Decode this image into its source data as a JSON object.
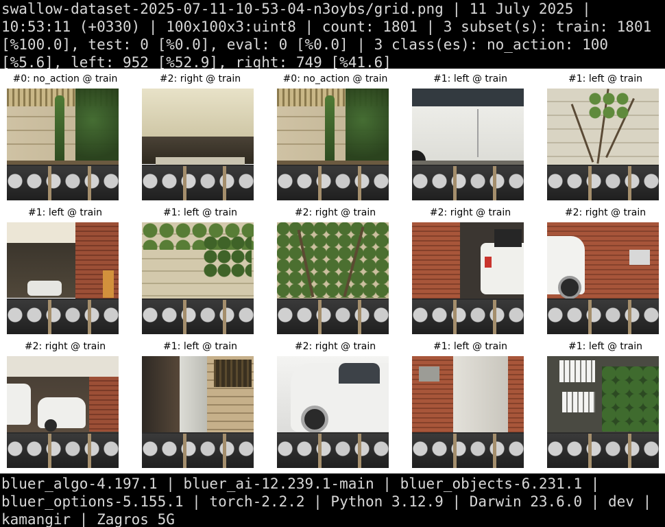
{
  "header": {
    "text": "swallow-dataset-2025-07-11-10-53-04-n3oybs/grid.png | 11 July 2025 | 10:53:11 (+0330) | 100x100x3:uint8 | count: 1801 | 3 subset(s): train: 1801 [%100.0], test: 0 [%0.0], eval: 0 [%0.0] | 3 class(es): no_action: 100 [%5.6], left: 952 [%52.9], right: 749 [%41.6]"
  },
  "grid": {
    "cells": [
      {
        "title": "#0: no_action @ train",
        "scene": "wall-plants"
      },
      {
        "title": "#2: right @ train",
        "scene": "garage-ceiling"
      },
      {
        "title": "#0: no_action @ train",
        "scene": "wall-plants"
      },
      {
        "title": "#1: left @ train",
        "scene": "white-car"
      },
      {
        "title": "#1: left @ train",
        "scene": "wall-branches"
      },
      {
        "title": "#1: left @ train",
        "scene": "garage-brick"
      },
      {
        "title": "#1: left @ train",
        "scene": "wall-vines"
      },
      {
        "title": "#2: right @ train",
        "scene": "vines-close"
      },
      {
        "title": "#2: right @ train",
        "scene": "car-trunk"
      },
      {
        "title": "#2: right @ train",
        "scene": "car-side-brick"
      },
      {
        "title": "#2: right @ train",
        "scene": "garage-cars"
      },
      {
        "title": "#1: left @ train",
        "scene": "pillar-wood"
      },
      {
        "title": "#2: right @ train",
        "scene": "white-car-close"
      },
      {
        "title": "#1: left @ train",
        "scene": "brick-pillar"
      },
      {
        "title": "#1: left @ train",
        "scene": "window-plant"
      }
    ]
  },
  "footer": {
    "text": "bluer_algo-4.197.1 | bluer_ai-12.239.1-main | bluer_objects-6.231.1 | bluer_options-5.155.1 | torch-2.2.2 | Python 3.12.9 | Darwin 23.6.0 | dev | kamangir | Zagros_5G"
  }
}
